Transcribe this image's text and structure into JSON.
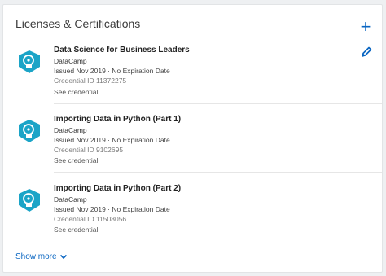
{
  "section": {
    "title": "Licenses & Certifications",
    "add_icon": "plus-icon",
    "edit_icon": "pencil-icon"
  },
  "certifications": [
    {
      "name": "Data Science for Business Leaders",
      "organization": "DataCamp",
      "dates": "Issued Nov 2019 · No Expiration Date",
      "credential": "Credential ID 11372275",
      "link": "See credential"
    },
    {
      "name": "Importing Data in Python (Part 1)",
      "organization": "DataCamp",
      "dates": "Issued Nov 2019 · No Expiration Date",
      "credential": "Credential ID 9102695",
      "link": "See credential"
    },
    {
      "name": "Importing Data in Python (Part 2)",
      "organization": "DataCamp",
      "dates": "Issued Nov 2019 · No Expiration Date",
      "credential": "Credential ID 11508056",
      "link": "See credential"
    }
  ],
  "footer": {
    "show_more": "Show more"
  },
  "colors": {
    "accent": "#0a66c2",
    "logo": "#1ba4c7"
  }
}
